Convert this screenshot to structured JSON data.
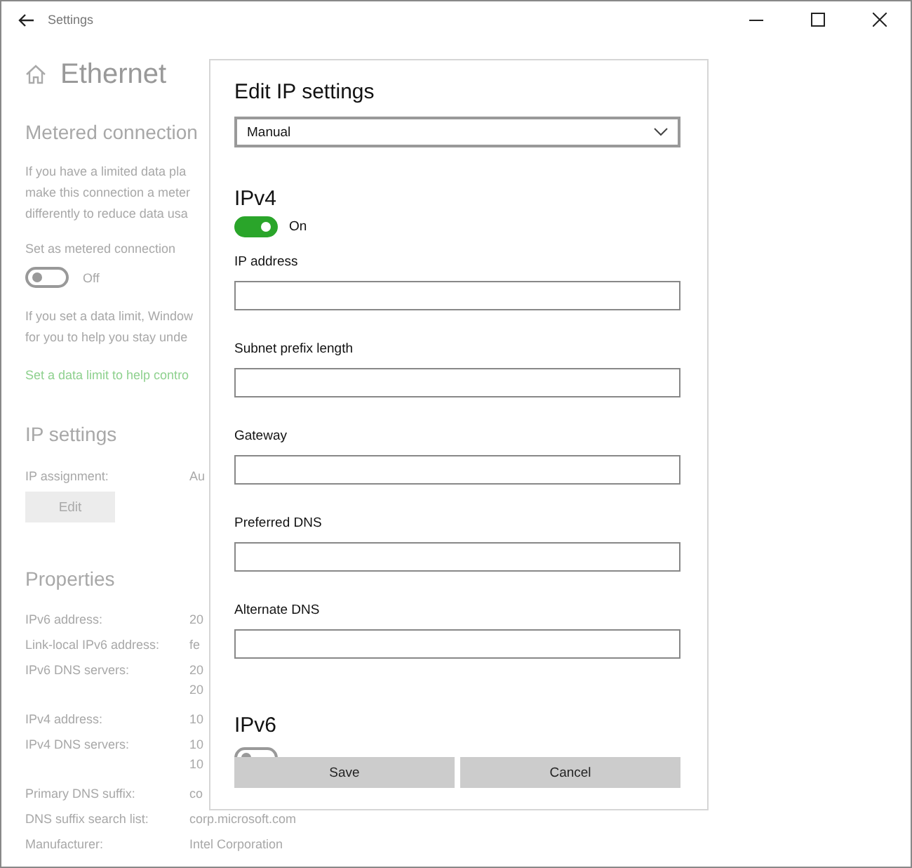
{
  "window": {
    "title": "Settings"
  },
  "page": {
    "title": "Ethernet",
    "metered": {
      "heading": "Metered connection",
      "intro": [
        "If you have a limited data pla",
        "make this connection a meter",
        "differently to reduce data usa"
      ],
      "toggle_label": "Set as metered connection",
      "toggle": {
        "on": false,
        "label": "Off"
      },
      "limit_text": [
        "If you set a data limit, Window",
        "for you to help you stay unde"
      ],
      "link": "Set a data limit to help contro"
    },
    "ip_settings": {
      "heading": "IP settings",
      "assignment_label": "IP assignment:",
      "assignment_value": "Au",
      "edit_button": "Edit"
    },
    "properties": {
      "heading": "Properties",
      "rows": [
        {
          "label": "IPv6 address:",
          "values": [
            "20"
          ]
        },
        {
          "label": "Link-local IPv6 address:",
          "values": [
            "fe"
          ]
        },
        {
          "label": "IPv6 DNS servers:",
          "values": [
            "20",
            "20"
          ]
        },
        {
          "label": "IPv4 address:",
          "values": [
            "10"
          ]
        },
        {
          "label": "IPv4 DNS servers:",
          "values": [
            "10",
            "10"
          ]
        },
        {
          "label": "Primary DNS suffix:",
          "values": [
            "co"
          ]
        },
        {
          "label": "DNS suffix search list:",
          "values": [
            "corp.microsoft.com"
          ]
        },
        {
          "label": "Manufacturer:",
          "values": [
            "Intel Corporation"
          ]
        }
      ]
    }
  },
  "dialog": {
    "title": "Edit IP settings",
    "mode": "Manual",
    "ipv4": {
      "heading": "IPv4",
      "toggle": {
        "on": true,
        "label": "On"
      },
      "fields": [
        "IP address",
        "Subnet prefix length",
        "Gateway",
        "Preferred DNS",
        "Alternate DNS"
      ]
    },
    "ipv6": {
      "heading": "IPv6",
      "toggle": {
        "on": false
      }
    },
    "buttons": [
      "Save",
      "Cancel"
    ]
  }
}
